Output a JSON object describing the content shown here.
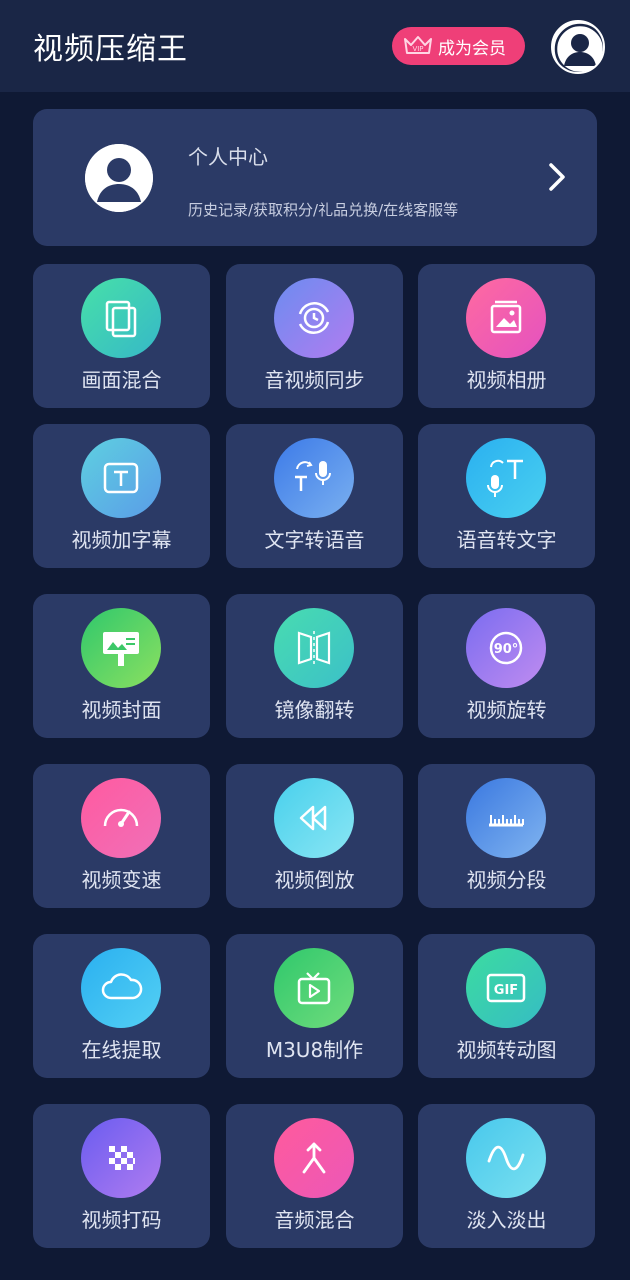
{
  "header": {
    "title": "视频压缩王",
    "vip_label": "成为会员",
    "vip_badge": "VIP"
  },
  "profile": {
    "title": "个人中心",
    "subtitle": "历史记录/获取积分/礼品兑换/在线客服等"
  },
  "features": [
    {
      "label": "画面混合",
      "icon": "layers-icon",
      "color": "#3fd6b4"
    },
    {
      "label": "音视频同步",
      "icon": "sync-clock-icon",
      "color": "#a07cf0"
    },
    {
      "label": "视频相册",
      "icon": "photo-album-icon",
      "color": "#f45aa8"
    },
    {
      "label": "视频加字幕",
      "icon": "subtitle-icon",
      "color": "#5fc6e8"
    },
    {
      "label": "文字转语音",
      "icon": "text-to-speech-icon",
      "color": "#4a8ce8"
    },
    {
      "label": "语音转文字",
      "icon": "speech-to-text-icon",
      "color": "#3fb8f0"
    },
    {
      "label": "视频封面",
      "icon": "billboard-icon",
      "color": "#4dd46c"
    },
    {
      "label": "镜像翻转",
      "icon": "mirror-flip-icon",
      "color": "#3fd6b4"
    },
    {
      "label": "视频旋转",
      "icon": "rotate-90-icon",
      "color": "#9a7cf0"
    },
    {
      "label": "视频变速",
      "icon": "speedometer-icon",
      "color": "#f45aa8"
    },
    {
      "label": "视频倒放",
      "icon": "rewind-icon",
      "color": "#6adcf0"
    },
    {
      "label": "视频分段",
      "icon": "ruler-icon",
      "color": "#4a8ce8"
    },
    {
      "label": "在线提取",
      "icon": "cloud-icon",
      "color": "#3fb8f0"
    },
    {
      "label": "M3U8制作",
      "icon": "tv-play-icon",
      "color": "#4dd46c"
    },
    {
      "label": "视频转动图",
      "icon": "gif-icon",
      "color": "#3fd6b4"
    },
    {
      "label": "视频打码",
      "icon": "mosaic-icon",
      "color": "#9a6cf0"
    },
    {
      "label": "音频混合",
      "icon": "merge-icon",
      "color": "#f45aa8"
    },
    {
      "label": "淡入淡出",
      "icon": "wave-icon",
      "color": "#5fd2ec"
    }
  ]
}
